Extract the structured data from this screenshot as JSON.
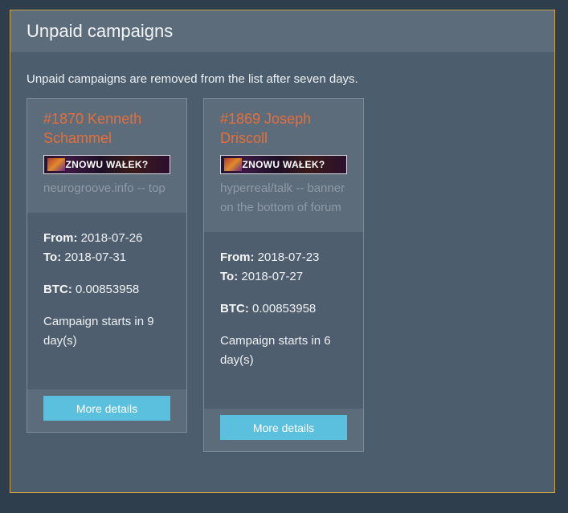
{
  "panel": {
    "title": "Unpaid campaigns",
    "notice": "Unpaid campaigns are removed from the list after seven days."
  },
  "campaigns": [
    {
      "title": "#1870 Kenneth Schammel",
      "banner_text": "ZNOWU WAŁEK?",
      "placement": "neurogroove.info -- top",
      "from_label": "From:",
      "from": "2018-07-26",
      "to_label": "To:",
      "to": "2018-07-31",
      "btc_label": "BTC:",
      "btc": "0.00853958",
      "starts": "Campaign starts in 9 day(s)",
      "button": "More details"
    },
    {
      "title": "#1869 Joseph Driscoll",
      "banner_text": "ZNOWU WAŁEK?",
      "placement": "hyperreal/talk -- banner on the bottom of forum",
      "from_label": "From:",
      "from": "2018-07-23",
      "to_label": "To:",
      "to": "2018-07-27",
      "btc_label": "BTC:",
      "btc": "0.00853958",
      "starts": "Campaign starts in 6 day(s)",
      "button": "More details"
    }
  ],
  "colors": {
    "accent": "#e56f3a",
    "button": "#5bc0de",
    "panel_border": "#c9a24a"
  }
}
